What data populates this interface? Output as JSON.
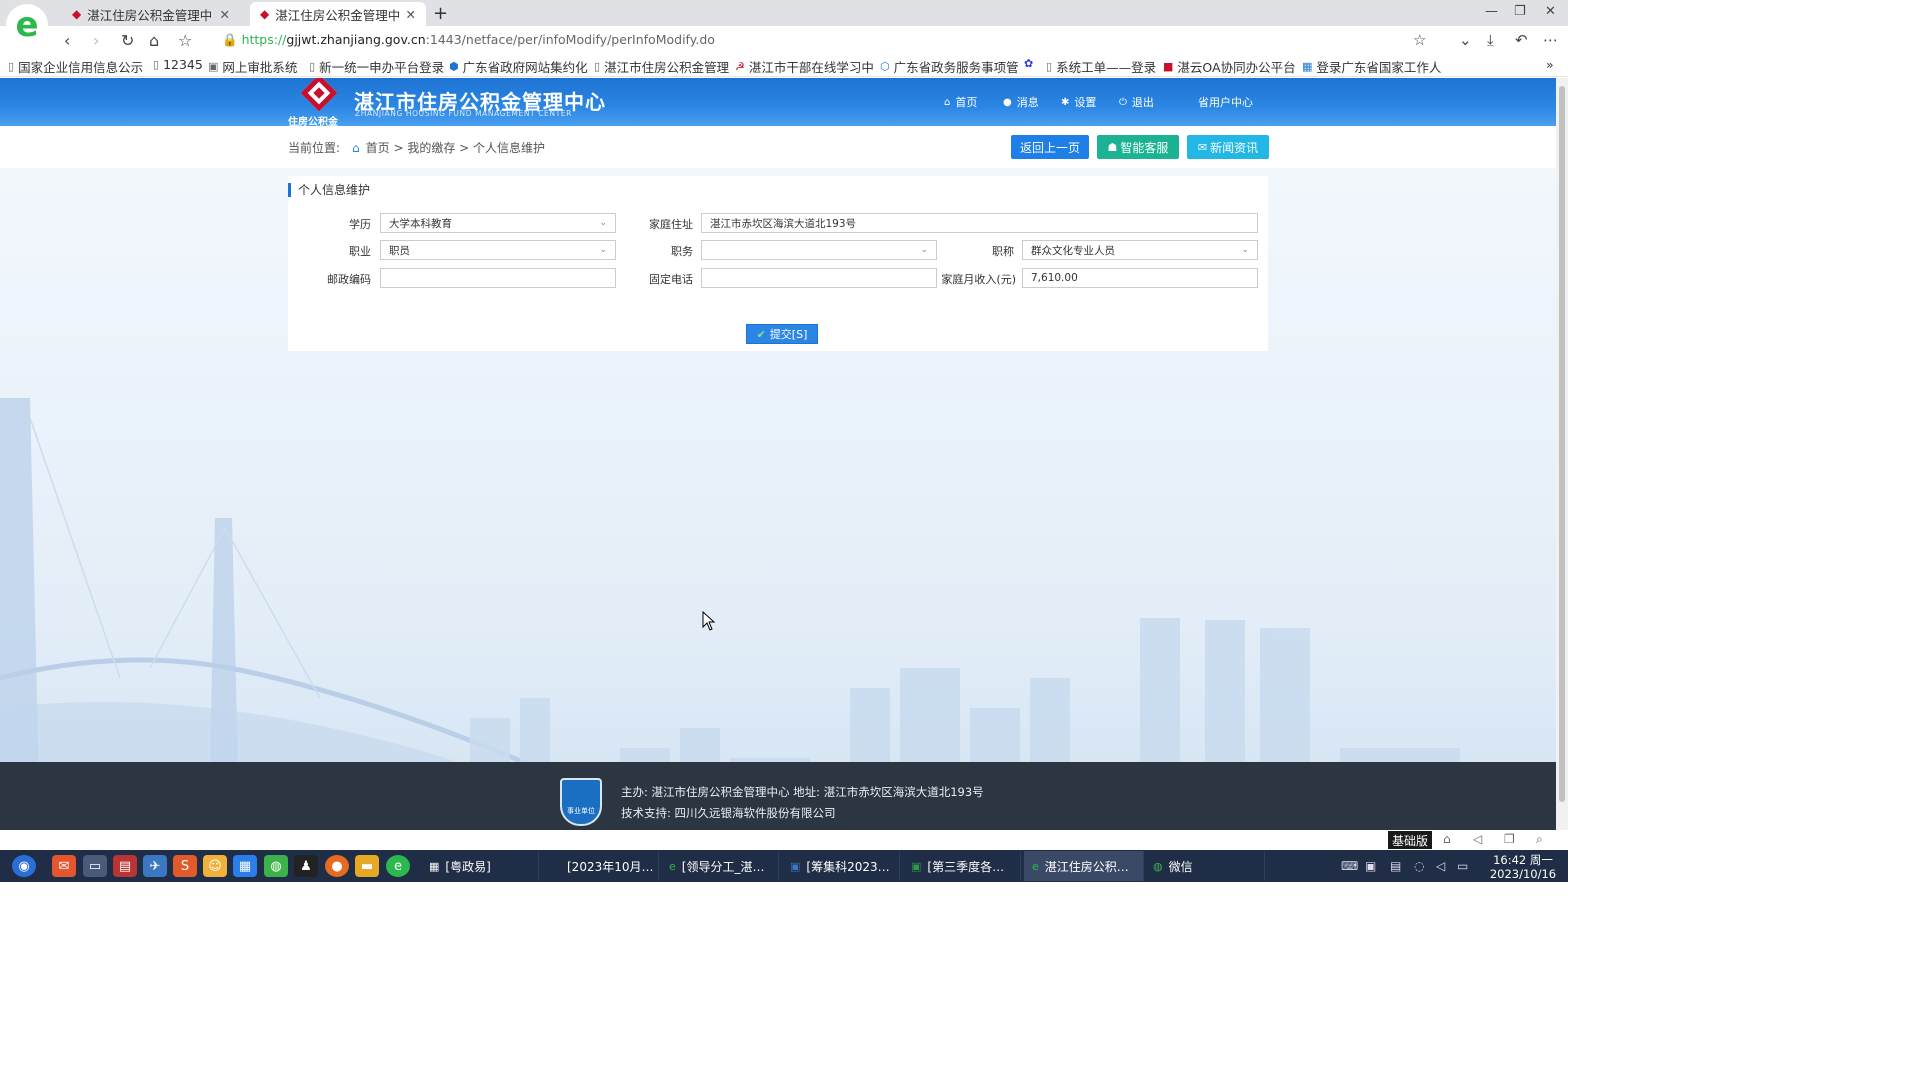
{
  "browser": {
    "tabs": [
      {
        "label": "湛江住房公积金管理中",
        "active": false
      },
      {
        "label": "湛江住房公积金管理中",
        "active": true
      }
    ],
    "new_tab": "+",
    "url": {
      "scheme": "https://",
      "host": "gjjwt.zhanjiang.gov.cn",
      "rest": ":1443/netface/per/infoModify/perInfoModify.do"
    },
    "bookmarks": [
      "国家企业信用信息公示",
      "12345",
      "网上审批系统",
      "新一统一申办平台登录",
      "广东省政府网站集约化",
      "湛江市住房公积金管理",
      "湛江市干部在线学习中",
      "广东省政务服务事项管",
      "",
      "系统工单——登录",
      "湛云OA协同办公平台",
      "登录广东省国家工作人"
    ]
  },
  "site": {
    "logo_sub": "住房公积金",
    "title": "湛江市住房公积金管理中心",
    "subtitle": "ZHANJIANG HOUSING FUND MANAGEMENT CENTER",
    "nav": [
      "首页",
      "消息",
      "设置",
      "退出",
      "省用户中心"
    ]
  },
  "breadcrumb": {
    "prefix": "当前位置:",
    "path": "首页 > 我的缴存 > 个人信息维护"
  },
  "actions": {
    "back": "返回上一页",
    "service": "智能客服",
    "news": "新闻资讯"
  },
  "form": {
    "title": "个人信息维护",
    "education_label": "学历",
    "education_value": "大学本科教育",
    "address_label": "家庭住址",
    "address_value": "湛江市赤坎区海滨大道北193号",
    "occupation_label": "职业",
    "occupation_value": "职员",
    "position_label": "职务",
    "position_value": "",
    "title_rank_label": "职称",
    "title_rank_value": "群众文化专业人员",
    "postcode_label": "邮政编码",
    "postcode_value": "",
    "phone_label": "固定电话",
    "phone_value": "",
    "income_label": "家庭月收入(元)",
    "income_value": "7,610.00",
    "submit": "提交[S]"
  },
  "footer": {
    "emblem_text": "事业单位",
    "line1": "主办: 湛江市住房公积金管理中心  地址: 湛江市赤坎区海滨大道北193号",
    "line2": "技术支持: 四川久远银海软件股份有限公司"
  },
  "status_strip": {
    "mode": "基础版"
  },
  "taskbar": {
    "tasks": [
      {
        "label": "[粤政易]",
        "active": false
      },
      {
        "label": "[2023年10月…",
        "active": false
      },
      {
        "label": "[领导分工_湛…",
        "active": false
      },
      {
        "label": "[筹集科2023…",
        "active": false
      },
      {
        "label": "[第三季度各…",
        "active": false
      },
      {
        "label": "湛江住房公积…",
        "active": true
      },
      {
        "label": "微信",
        "active": false
      }
    ],
    "time": "16:42 周一",
    "date": "2023/10/16"
  },
  "colors": {
    "brand": "#1e73d2",
    "service": "#1cb394",
    "news": "#23b7e5",
    "logo_red": "#c8102e"
  }
}
